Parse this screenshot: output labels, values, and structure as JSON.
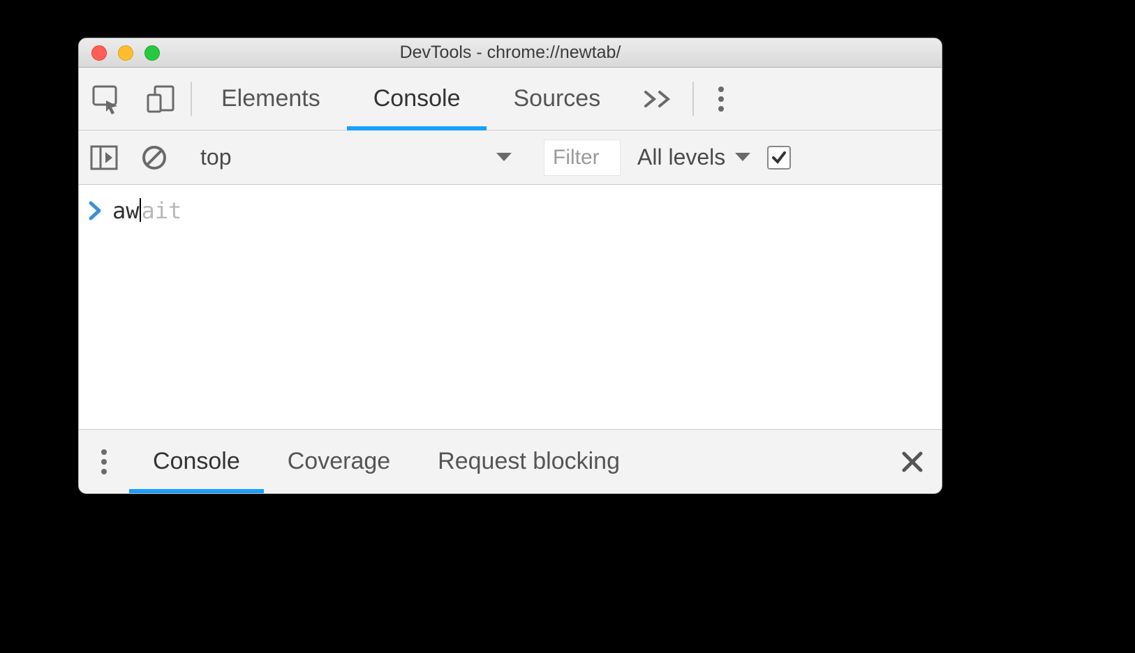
{
  "window": {
    "title": "DevTools - chrome://newtab/"
  },
  "main_tabs": {
    "items": [
      "Elements",
      "Console",
      "Sources"
    ],
    "active_index": 1
  },
  "console_toolbar": {
    "context": "top",
    "filter_placeholder": "Filter",
    "levels_label": "All levels",
    "group_similar_checked": true
  },
  "console": {
    "prompt_typed": "aw",
    "prompt_ghost": "ait"
  },
  "drawer": {
    "items": [
      "Console",
      "Coverage",
      "Request blocking"
    ],
    "active_index": 0
  }
}
